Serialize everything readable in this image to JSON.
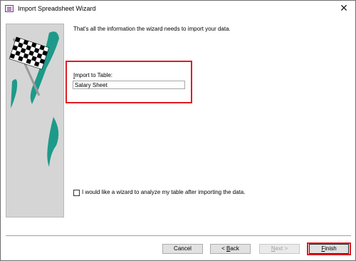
{
  "window": {
    "title": "Import Spreadsheet Wizard",
    "close_glyph": "✕"
  },
  "intro_text": "That's all the information the wizard needs to import your data.",
  "import_field": {
    "label_first": "I",
    "label_rest": "mport to Table:",
    "value": "Salary Sheet"
  },
  "analyze_option": {
    "label": "I would like a wizard to analyze my table after importing the data.",
    "checked": false
  },
  "buttons": {
    "cancel": "Cancel",
    "back_prefix": "< ",
    "back_accel": "B",
    "back_rest": "ack",
    "next_prefix": "",
    "next_accel": "N",
    "next_rest": "ext >",
    "finish_accel": "F",
    "finish_rest": "inish"
  },
  "colors": {
    "highlight": "#e01a23",
    "flag_swoosh": "#1e9a8a"
  },
  "icons": {
    "app": "access-table-icon",
    "close": "close-icon",
    "wizard_art": "checkered-flag-icon"
  }
}
